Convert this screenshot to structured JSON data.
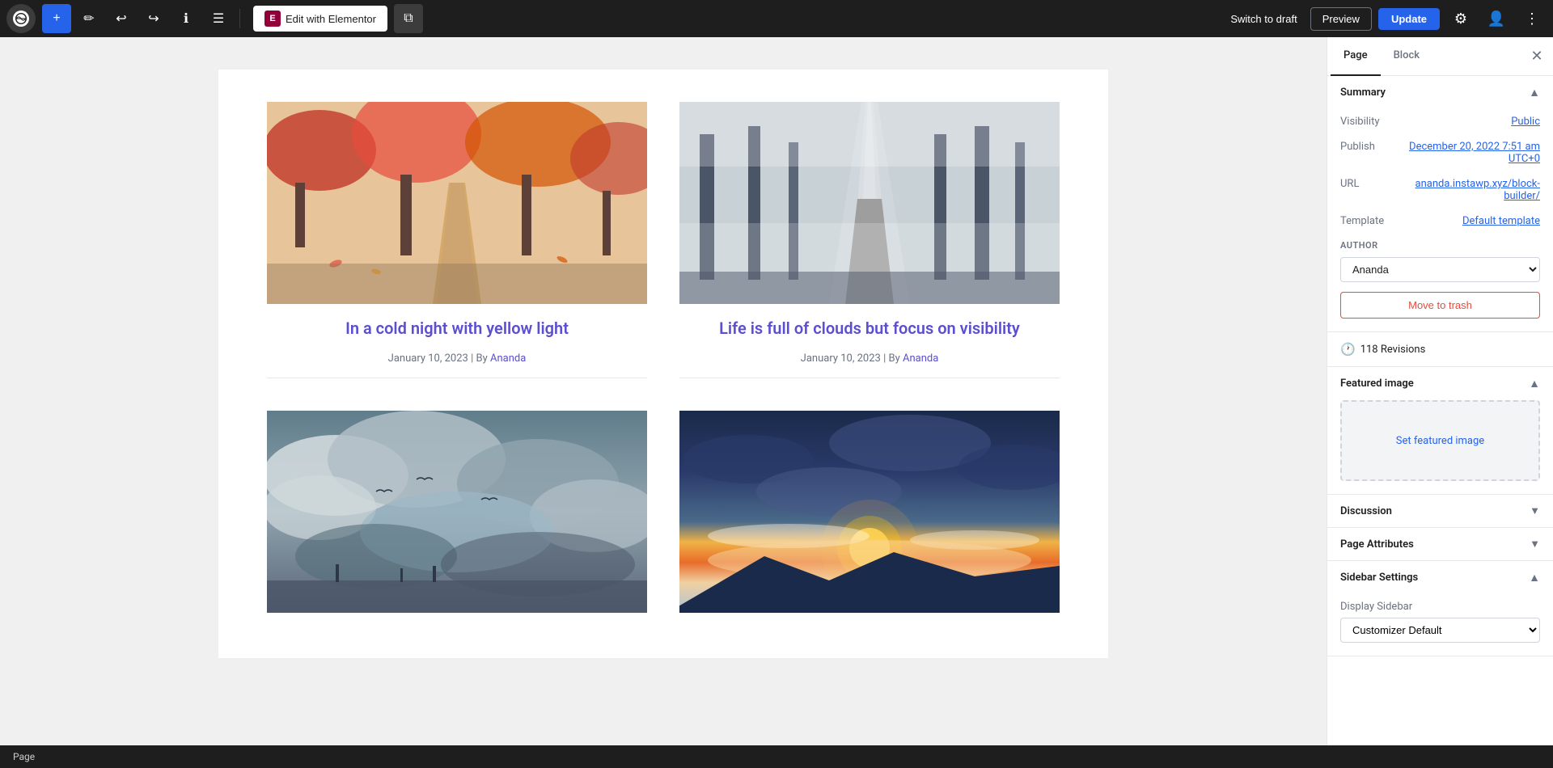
{
  "toolbar": {
    "add_label": "+",
    "wp_logo_label": "W",
    "elementor_label": "Edit with Elementor",
    "elementor_icon": "E",
    "switch_draft_label": "Switch to draft",
    "preview_label": "Preview",
    "update_label": "Update"
  },
  "tabs": {
    "page_label": "Page",
    "block_label": "Block"
  },
  "summary": {
    "title": "Summary",
    "visibility_label": "Visibility",
    "visibility_value": "Public",
    "publish_label": "Publish",
    "publish_value": "December 20, 2022 7:51 am UTC+0",
    "url_label": "URL",
    "url_value": "ananda.instawp.xyz/block-builder/",
    "template_label": "Template",
    "template_value": "Default template",
    "author_label": "AUTHOR",
    "author_value": "Ananda"
  },
  "move_trash": {
    "label": "Move to trash"
  },
  "revisions": {
    "label": "118 Revisions"
  },
  "featured_image": {
    "title": "Featured image",
    "set_label": "Set featured image"
  },
  "discussion": {
    "title": "Discussion"
  },
  "page_attributes": {
    "title": "Page Attributes"
  },
  "sidebar_settings": {
    "title": "Sidebar Settings",
    "display_label": "Display Sidebar",
    "display_value": "Customizer Default"
  },
  "posts": [
    {
      "title": "In a cold night with yellow light",
      "date": "January 10, 2023",
      "by": "By",
      "author": "Ananda",
      "image_type": "autumn"
    },
    {
      "title": "Life is full of clouds but focus on visibility",
      "date": "January 10, 2023",
      "by": "By",
      "author": "Ananda",
      "image_type": "forest"
    },
    {
      "title": "",
      "date": "",
      "by": "",
      "author": "",
      "image_type": "clouds"
    },
    {
      "title": "",
      "date": "",
      "by": "",
      "author": "",
      "image_type": "sunset"
    }
  ],
  "bottom_bar": {
    "label": "Page"
  }
}
